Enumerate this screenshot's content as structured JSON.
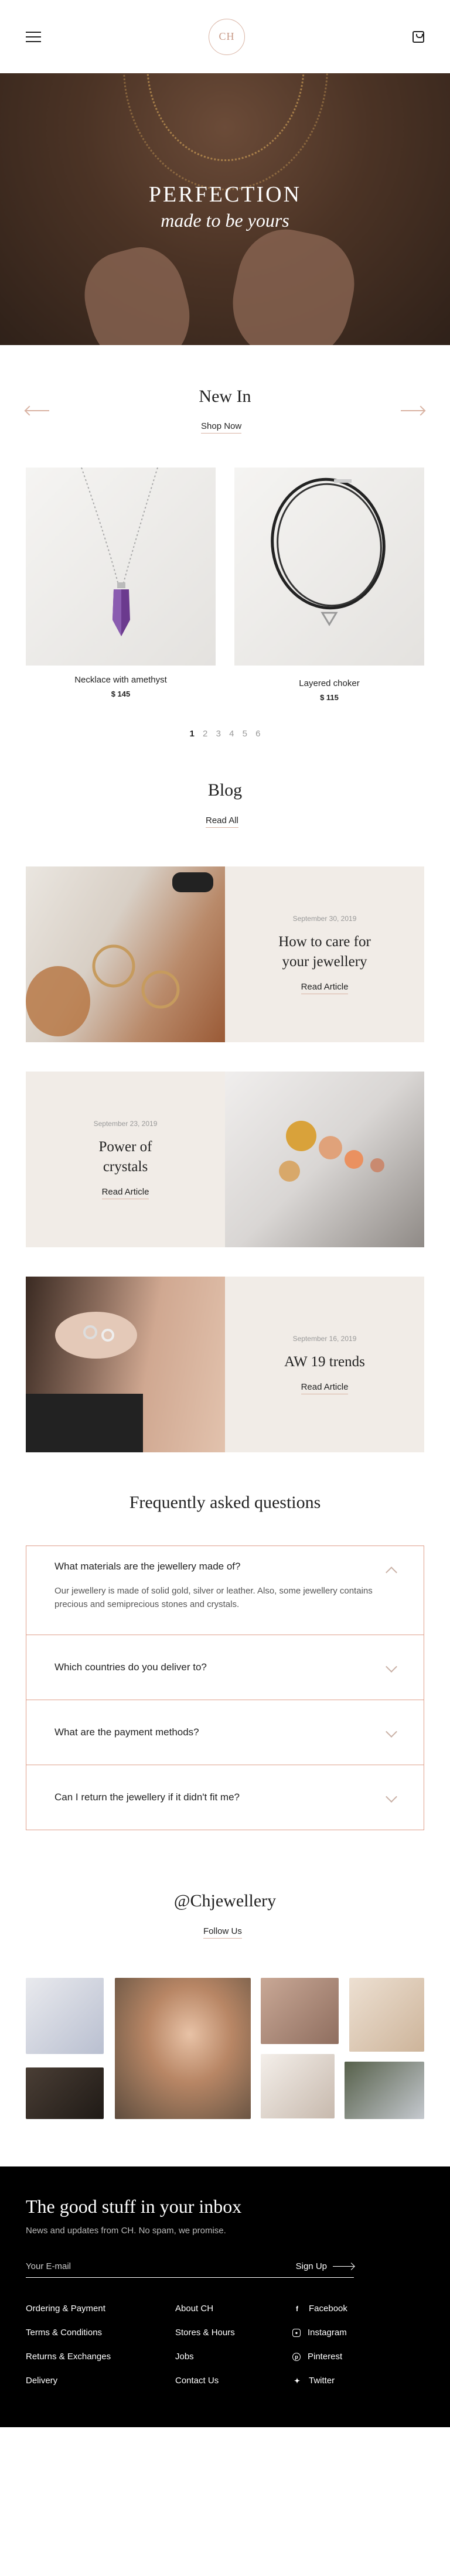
{
  "header": {
    "logo": "CH"
  },
  "hero": {
    "title": "PERFECTION",
    "subtitle": "made to be yours"
  },
  "new_in": {
    "title": "New In",
    "shop_now": "Shop Now",
    "products": [
      {
        "name": "Necklace with amethyst",
        "price": "$ 145"
      },
      {
        "name": "Layered choker",
        "price": "$ 115"
      }
    ],
    "pages": [
      "1",
      "2",
      "3",
      "4",
      "5",
      "6"
    ]
  },
  "blog": {
    "title": "Blog",
    "read_all": "Read All",
    "posts": [
      {
        "date": "September 30, 2019",
        "title": "How to care for your jewellery",
        "link": "Read Article"
      },
      {
        "date": "September 23, 2019",
        "title": "Power of crystals",
        "link": "Read Article"
      },
      {
        "date": "September 16, 2019",
        "title": "AW 19 trends",
        "link": "Read Article"
      }
    ]
  },
  "faq": {
    "title": "Frequently asked questions",
    "items": [
      {
        "q": "What materials are the jewellery made of?",
        "a": "Our jewellery is made of solid gold, silver or leather.  Also, some jewellery contains precious and semiprecious stones and crystals."
      },
      {
        "q": "Which countries do you deliver to?"
      },
      {
        "q": "What are the payment methods?"
      },
      {
        "q": "Can I return the jewellery if it didn't fit me?"
      }
    ]
  },
  "instagram": {
    "title": "@Chjewellery",
    "follow": "Follow Us"
  },
  "footer": {
    "title": "The good stuff in your inbox",
    "subtitle": "News and updates from CH. No spam, we promise.",
    "email_placeholder": "Your E-mail",
    "signup": "Sign Up",
    "col1": [
      "Ordering & Payment",
      "Terms & Conditions",
      "Returns & Exchanges",
      "Delivery"
    ],
    "col2": [
      "About CH",
      "Stores & Hours",
      "Jobs",
      "Contact Us"
    ],
    "social": [
      "Facebook",
      "Instagram",
      "Pinterest",
      "Twitter"
    ]
  },
  "colors": {
    "accent": "#d9b3a3",
    "blog_bg": "#f1ece7",
    "footer_bg": "#000000"
  }
}
